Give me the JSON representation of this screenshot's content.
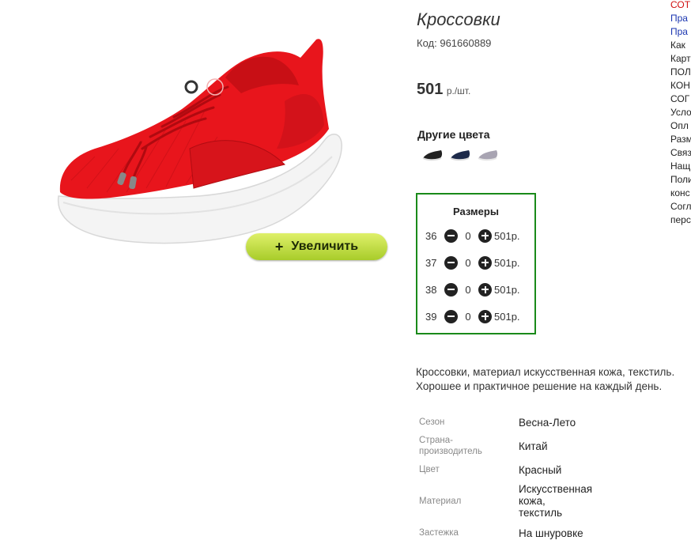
{
  "product": {
    "title": "Кроссовки",
    "code_label": "Код:",
    "code": "961660889",
    "price": "501",
    "price_unit": "р./шт.",
    "zoom_button": "Увеличить",
    "zoom_plus": "+",
    "main_color": "#e8151c"
  },
  "other_colors": {
    "title": "Другие цвета",
    "swatches": [
      "black-sneaker",
      "navy-sneaker",
      "grey-sneaker"
    ]
  },
  "sizes": {
    "title": "Размеры",
    "rows": [
      {
        "size": "36",
        "qty": "0",
        "price": "501р."
      },
      {
        "size": "37",
        "qty": "0",
        "price": "501р."
      },
      {
        "size": "38",
        "qty": "0",
        "price": "501р."
      },
      {
        "size": "39",
        "qty": "0",
        "price": "501р."
      }
    ]
  },
  "description": {
    "line1": "Кроссовки, материал искусственная кожа, текстиль.",
    "line2": "Хорошее и практичное решение на каждый день."
  },
  "specs": [
    {
      "label": "Сезон",
      "value": "Весна-Лето"
    },
    {
      "label_line1": "Страна-",
      "label_line2": "производитель",
      "value": "Китай"
    },
    {
      "label": "Цвет",
      "value": "Красный"
    },
    {
      "label": "Материал",
      "value_line1": "Искусственная",
      "value_line2": "кожа,",
      "value_line3": "текстиль"
    },
    {
      "label": "Застежка",
      "value": "На шнуровке"
    }
  ],
  "right_links": [
    "СОТ",
    "Пра",
    "Пра",
    "Как",
    "Карт",
    "ПОЛ",
    "КОН",
    "СОГ",
    "Усло",
    "Опл",
    "Разм",
    "Связ",
    "Нащ",
    "Поли",
    "конс",
    "Согл",
    "перс"
  ],
  "colors": {
    "accent_green": "#1a8a1a",
    "zoom_button": "#c4e04a",
    "link_red": "#d01010",
    "link_blue": "#1a35b0"
  }
}
